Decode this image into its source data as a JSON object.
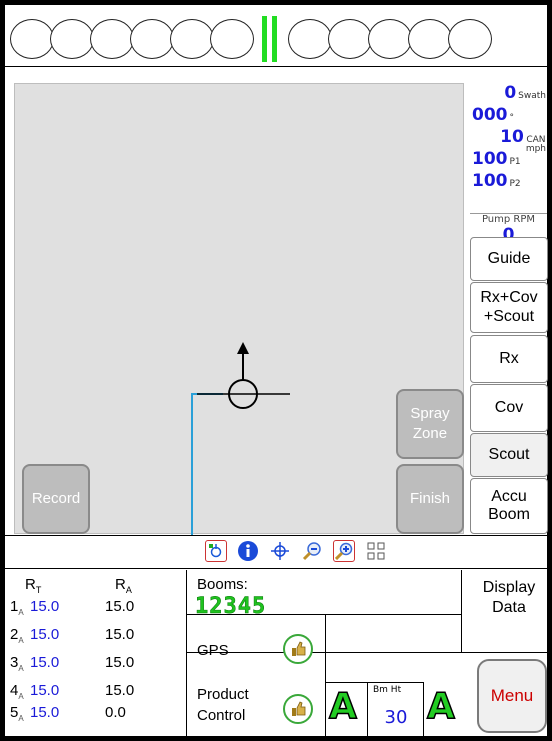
{
  "swath": {
    "value": "0",
    "unit": "Swath"
  },
  "heading": {
    "value": "000",
    "unit": "°"
  },
  "speed": {
    "value": "10",
    "unit_top": "CAN",
    "unit_bottom": "mph"
  },
  "p1": {
    "value": "100",
    "unit": "P1"
  },
  "p2": {
    "value": "100",
    "unit": "P2"
  },
  "pump": {
    "label": "Pump RPM",
    "value": "0"
  },
  "side_buttons": {
    "guide": "Guide",
    "rxcov_1": "Rx+Cov",
    "rxcov_2": "+Scout",
    "rx": "Rx",
    "cov": "Cov",
    "scout": "Scout",
    "accu_1": "Accu",
    "accu_2": "Boom"
  },
  "map_buttons": {
    "record": "Record",
    "spray_1": "Spray",
    "spray_2": "Zone",
    "finish": "Finish"
  },
  "rates": {
    "header_t": "R",
    "header_t_sub": "T",
    "header_a": "R",
    "header_a_sub": "A",
    "rows": [
      {
        "n": "1",
        "sub": "A",
        "target": "15.0",
        "actual": "15.0"
      },
      {
        "n": "2",
        "sub": "A",
        "target": "15.0",
        "actual": "15.0"
      },
      {
        "n": "3",
        "sub": "A",
        "target": "15.0",
        "actual": "15.0"
      },
      {
        "n": "4",
        "sub": "A",
        "target": "15.0",
        "actual": "15.0"
      },
      {
        "n": "5",
        "sub": "A",
        "target": "15.0",
        "actual": "0.0"
      }
    ]
  },
  "booms": {
    "label": "Booms:",
    "value": "12345"
  },
  "gps": {
    "label": "GPS"
  },
  "product_control": {
    "line1": "Product",
    "line2": "Control"
  },
  "auto_a": "A",
  "bm_ht": {
    "label": "Bm Ht",
    "value": "30"
  },
  "display_data": {
    "line1": "Display",
    "line2": "Data"
  },
  "menu": "Menu",
  "colors": {
    "accent_blue": "#1a1ad8",
    "green": "#22cc22",
    "menu_red": "#cc0000",
    "map_bg": "#e0e0e0"
  },
  "icons": [
    "location-marker-icon",
    "info-icon",
    "center-crosshair-icon",
    "zoom-out-icon",
    "zoom-in-icon",
    "expand-view-icon"
  ]
}
